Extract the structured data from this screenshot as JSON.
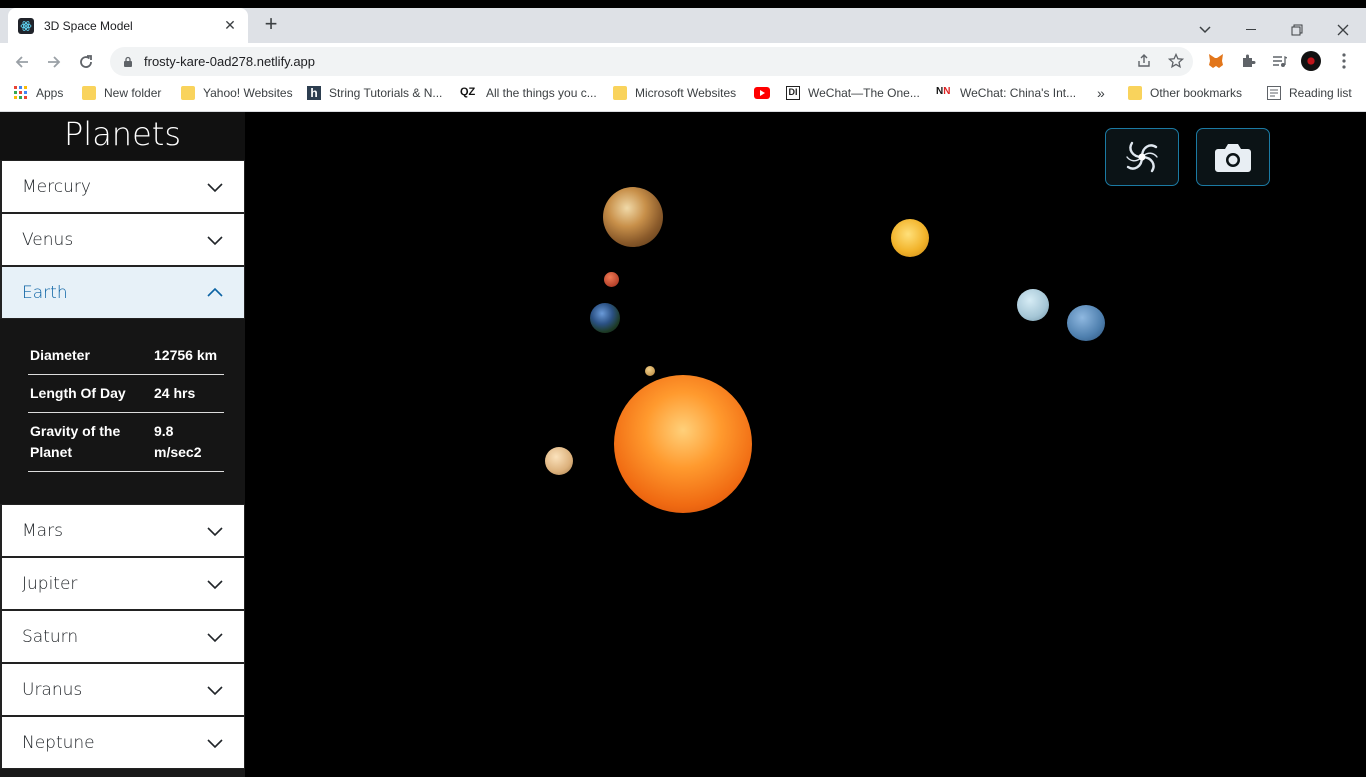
{
  "browser": {
    "tab_title": "3D Space Model",
    "url": "frosty-kare-0ad278.netlify.app",
    "bookmarks": [
      {
        "label": "Apps",
        "icon": "apps-grid-icon"
      },
      {
        "label": "New folder",
        "icon": "folder-icon"
      },
      {
        "label": "Yahoo! Websites",
        "icon": "folder-icon"
      },
      {
        "label": "String Tutorials & N...",
        "icon": "h-site-icon"
      },
      {
        "label": "All the things you c...",
        "icon": "qz-icon"
      },
      {
        "label": "Microsoft Websites",
        "icon": "folder-icon"
      },
      {
        "label": "",
        "icon": "youtube-icon"
      },
      {
        "label": "WeChat—The One...",
        "icon": "di-site-icon"
      },
      {
        "label": "WeChat: China's Int...",
        "icon": "nn-site-icon"
      },
      {
        "label": "»",
        "icon": "more-bookmarks-icon"
      },
      {
        "label": "Other bookmarks",
        "icon": "folder-icon"
      },
      {
        "label": "Reading list",
        "icon": "reading-list-icon"
      }
    ]
  },
  "sidebar": {
    "title": "Planets",
    "planets_before": [
      {
        "label": "Mercury"
      },
      {
        "label": "Venus"
      }
    ],
    "active": {
      "label": "Earth",
      "details": [
        {
          "key": "Diameter",
          "value": "12756 km"
        },
        {
          "key": "Length Of Day",
          "value": "24 hrs"
        },
        {
          "key": "Gravity of the Planet",
          "value": "9.8 m/sec2"
        }
      ]
    },
    "planets_after": [
      {
        "label": "Mars"
      },
      {
        "label": "Jupiter"
      },
      {
        "label": "Saturn"
      },
      {
        "label": "Uranus"
      },
      {
        "label": "Neptune"
      }
    ]
  },
  "scene": {
    "buttons": [
      {
        "icon": "galaxy-icon"
      },
      {
        "icon": "camera-icon"
      }
    ],
    "colors": {
      "accent": "#1b7aa3",
      "active_label": "#0c63a4",
      "active_bg": "#e7f1f8"
    }
  }
}
